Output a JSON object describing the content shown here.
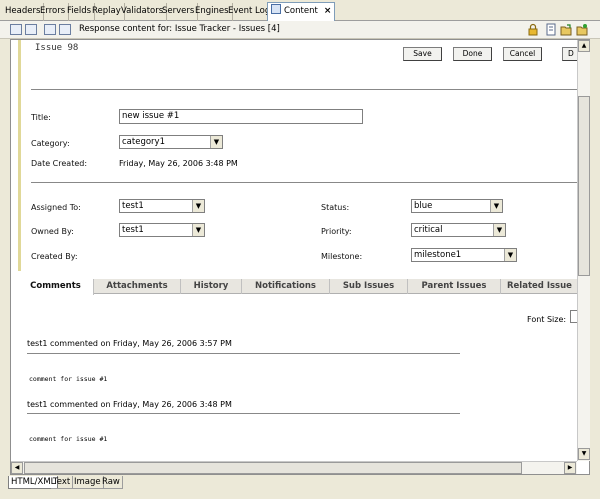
{
  "top_tabs": [
    "Headers",
    "Errors",
    "Fields",
    "Replay",
    "Validators",
    "Servers",
    "Engines",
    "Event Log"
  ],
  "active_tab": "Content",
  "toolbar_text": "Response content for: Issue Tracker - Issues [4]",
  "issue": {
    "title": "Issue 98",
    "buttons": {
      "save": "Save",
      "done": "Done",
      "cancel": "Cancel",
      "delete": "D"
    },
    "title_label": "Title:",
    "title_value": "new issue #1",
    "category_label": "Category:",
    "category_value": "category1",
    "date_created_label": "Date Created:",
    "date_created_value": "Friday, May 26, 2006 3:48 PM",
    "assigned_to_label": "Assigned To:",
    "assigned_to_value": "test1",
    "owned_by_label": "Owned By:",
    "owned_by_value": "test1",
    "created_by_label": "Created By:",
    "status_label": "Status:",
    "status_value": "blue",
    "priority_label": "Priority:",
    "priority_value": "critical",
    "milestone_label": "Milestone:",
    "milestone_value": "milestone1"
  },
  "subtabs": [
    "Comments",
    "Attachments",
    "History",
    "Notifications",
    "Sub Issues",
    "Parent Issues",
    "Related Issue"
  ],
  "font_size_label": "Font Size:",
  "comments": [
    {
      "header": "test1 commented on Friday, May 26, 2006 3:57 PM",
      "body": "comment for issue #1"
    },
    {
      "header": "test1 commented on Friday, May 26, 2006 3:48 PM",
      "body": "comment for issue #1"
    }
  ],
  "bottom_tabs": [
    "HTML/XML",
    "Text",
    "Image",
    "Raw"
  ]
}
